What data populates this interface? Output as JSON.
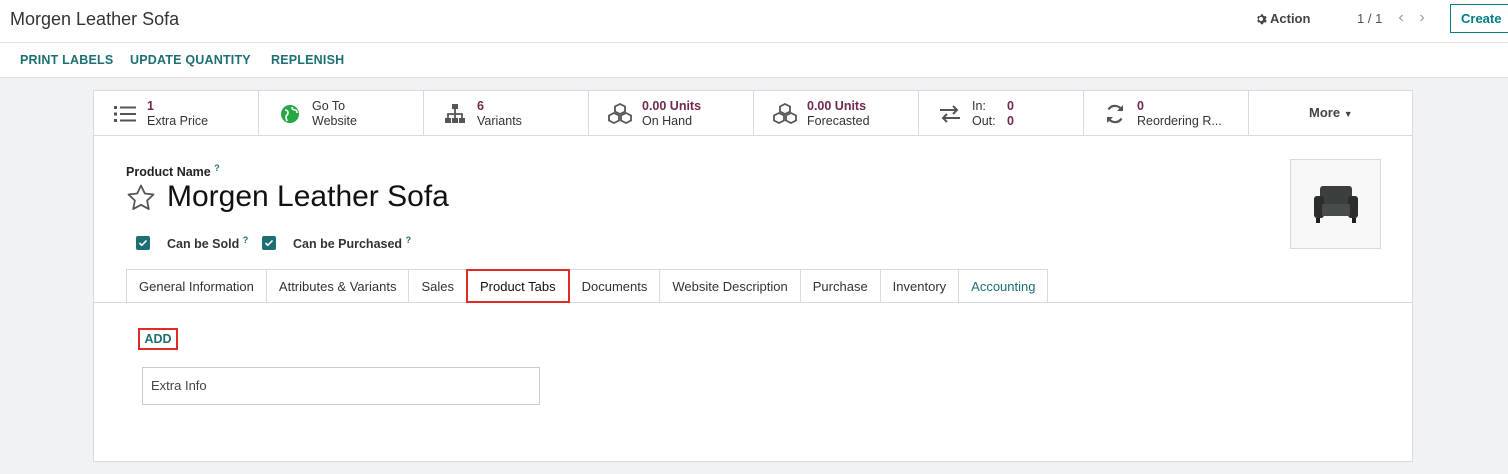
{
  "header": {
    "breadcrumb": "Morgen Leather Sofa",
    "action_label": "Action",
    "pager": "1 / 1",
    "create_label": "Create"
  },
  "button_bar": {
    "print_labels": "PRINT LABELS",
    "update_quantity": "UPDATE QUANTITY",
    "replenish": "REPLENISH"
  },
  "smart_buttons": {
    "extra_price": {
      "value": "1",
      "label": "Extra Price",
      "icon": "list-icon"
    },
    "website": {
      "line1": "Go To",
      "line2": "Website",
      "icon": "globe-icon"
    },
    "variants": {
      "value": "6",
      "label": "Variants",
      "icon": "sitemap-icon"
    },
    "on_hand": {
      "value": "0.00 Units",
      "label": "On Hand",
      "icon": "cubes-icon"
    },
    "forecasted": {
      "value": "0.00 Units",
      "label": "Forecasted",
      "icon": "cubes-icon"
    },
    "in_out": {
      "in_label": "In:",
      "in_value": "0",
      "out_label": "Out:",
      "out_value": "0",
      "icon": "exchange-icon"
    },
    "reordering": {
      "value": "0",
      "label": "Reordering R...",
      "icon": "refresh-icon"
    },
    "more_label": "More"
  },
  "form": {
    "product_name_label": "Product Name",
    "tooltip_mark": "?",
    "product_name": "Morgen Leather Sofa",
    "can_be_sold": {
      "label": "Can be Sold",
      "checked": true
    },
    "can_be_purchased": {
      "label": "Can be Purchased",
      "checked": true
    }
  },
  "tabs": [
    {
      "label": "General Information"
    },
    {
      "label": "Attributes & Variants"
    },
    {
      "label": "Sales"
    },
    {
      "label": "Product Tabs",
      "active": true
    },
    {
      "label": "Documents"
    },
    {
      "label": "Website Description"
    },
    {
      "label": "Purchase"
    },
    {
      "label": "Inventory"
    },
    {
      "label": "Accounting"
    }
  ],
  "product_tabs": {
    "add_label": "ADD",
    "rows": [
      {
        "name": "Extra Info"
      }
    ]
  },
  "colors": {
    "accent": "#1d6f73",
    "value": "#71294f",
    "highlight": "#e02b27"
  }
}
